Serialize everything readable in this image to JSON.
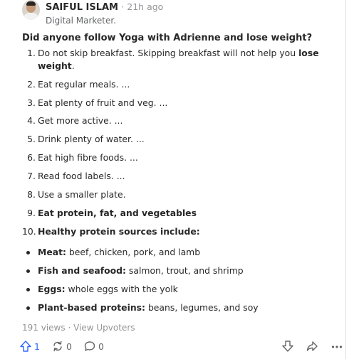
{
  "author": {
    "name": "SAIFUL ISLAM",
    "separator": "·",
    "time": "21h ago",
    "credential": "Digital Marketer."
  },
  "question": "Did anyone follow Yoga with Adrienne and lose weight?",
  "list": [
    {
      "num": "1.",
      "text": "Do not skip breakfast. Skipping breakfast will not help you ",
      "bold": "lose weight",
      "tail": "."
    },
    {
      "num": "2.",
      "text": "Eat regular meals. ..."
    },
    {
      "num": "3.",
      "text": "Eat plenty of fruit and veg. ..."
    },
    {
      "num": "4.",
      "text": "Get more active. ..."
    },
    {
      "num": "5.",
      "text": "Drink plenty of water. ..."
    },
    {
      "num": "6.",
      "text": "Eat high fibre foods. ..."
    },
    {
      "num": "7.",
      "text": "Read food labels. ..."
    },
    {
      "num": "8.",
      "text": "Use a smaller plate."
    },
    {
      "num": "9.",
      "bold": "Eat protein, fat, and vegetables"
    },
    {
      "num": "10.",
      "bold": "Healthy protein sources include:"
    }
  ],
  "bullets": [
    {
      "bold": "Meat:",
      "text": " beef, chicken, pork, and lamb"
    },
    {
      "bold": "Fish and seafood:",
      "text": " salmon, trout, and shrimp"
    },
    {
      "bold": "Eggs:",
      "text": " whole eggs with the yolk"
    },
    {
      "bold": "Plant-based proteins:",
      "text": " beans, legumes, and soy"
    }
  ],
  "stats": {
    "views": "191 views",
    "separator": "·",
    "upvoters_link": "View Upvoters"
  },
  "actions": {
    "upvotes": "1",
    "shares": "0",
    "comments": "0",
    "upvote_color": "#2e69ff"
  }
}
